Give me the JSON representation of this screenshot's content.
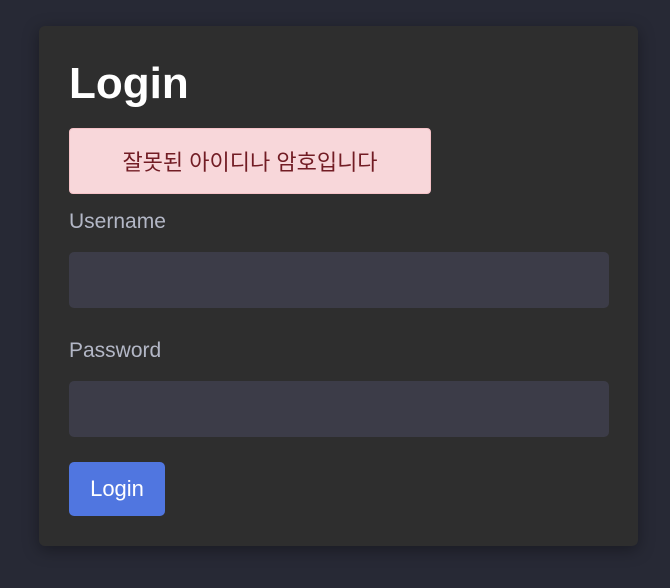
{
  "login_form": {
    "title": "Login",
    "error_message": "잘못된 아이디나 암호입니다",
    "username_label": "Username",
    "username_value": "",
    "password_label": "Password",
    "password_value": "",
    "submit_label": "Login"
  },
  "colors": {
    "background": "#272935",
    "card": "#2e2e2e",
    "input": "#3c3c48",
    "accent": "#5076e0",
    "error_bg": "#f8d7da",
    "error_text": "#721c24"
  }
}
